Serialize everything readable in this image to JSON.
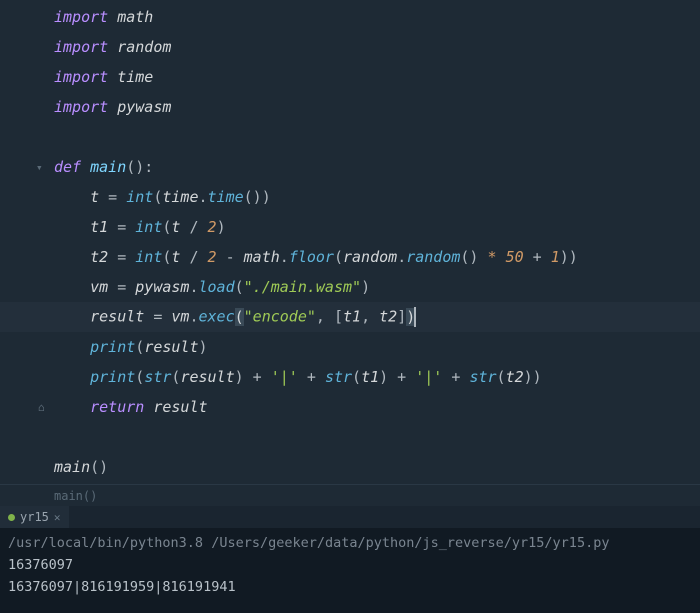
{
  "code": {
    "l1": {
      "kw": "import",
      "mod": "math"
    },
    "l2": {
      "kw": "import",
      "mod": "random"
    },
    "l3": {
      "kw": "import",
      "mod": "time"
    },
    "l4": {
      "kw": "import",
      "mod": "pywasm"
    },
    "l6": {
      "kw": "def",
      "name": "main",
      "sig": "():"
    },
    "l7": {
      "v": "t",
      "eq": " = ",
      "int": "int",
      "op": "(",
      "time1": "time",
      "dot1": ".",
      "time2": "time",
      "tail": "())"
    },
    "l8": {
      "v": "t1",
      "eq": " = ",
      "int": "int",
      "op1": "(",
      "v2": "t",
      "div": " / ",
      "n": "2",
      "op2": ")"
    },
    "l9": {
      "v": "t2",
      "eq": " = ",
      "int": "int",
      "op1": "(",
      "v2": "t",
      "div": " / ",
      "n2": "2",
      "minus": " - ",
      "math": "math",
      "dot": ".",
      "floor": "floor",
      "op2": "(",
      "random1": "random",
      "dot2": ".",
      "random2": "random",
      "op3": "() ",
      "star": "*",
      "sp": " ",
      "n50": "50",
      "plus": " + ",
      "n1": "1",
      "tail": "))"
    },
    "l10": {
      "v": "vm",
      "eq": " = ",
      "pywasm": "pywasm",
      "dot": ".",
      "load": "load",
      "op1": "(",
      "str": "\"./main.wasm\"",
      "op2": ")"
    },
    "l11": {
      "v": "result",
      "eq": " = ",
      "vm": "vm",
      "dot": ".",
      "exec": "exec",
      "hl1": "(",
      "str": "\"encode\"",
      "comma": ", [",
      "t1": "t1",
      "c2": ", ",
      "t2": "t2",
      "br": "]",
      "hl2": ")"
    },
    "l12": {
      "print": "print",
      "op1": "(",
      "v": "result",
      "op2": ")"
    },
    "l13": {
      "print": "print",
      "op1": "(",
      "str1": "str",
      "op2": "(",
      "v1": "result",
      "op3": ") + ",
      "q1": "'|'",
      "plus2": " + ",
      "str2": "str",
      "op4": "(",
      "v2": "t1",
      "op5": ") + ",
      "q2": "'|'",
      "plus3": " + ",
      "str3": "str",
      "op6": "(",
      "v3": "t2",
      "op7": "))"
    },
    "l14": {
      "kw": "return",
      "v": "result"
    },
    "l16": {
      "name": "main",
      "call": "()"
    }
  },
  "breadcrumb": "main()",
  "terminal": {
    "tab": {
      "name": "yr15"
    },
    "path_line": "/usr/local/bin/python3.8 /Users/geeker/data/python/js_reverse/yr15/yr15.py",
    "out1": "16376097",
    "out2": "16376097|816191959|816191941"
  }
}
